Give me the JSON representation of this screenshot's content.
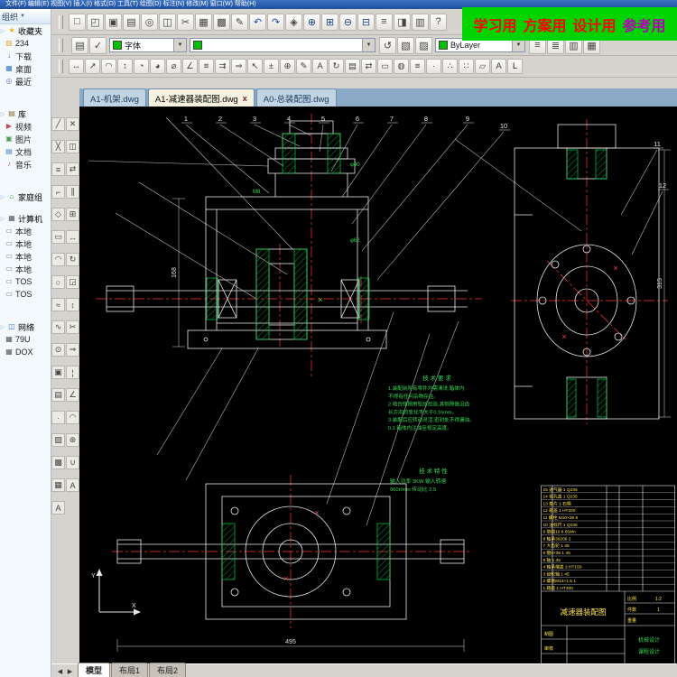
{
  "window": {
    "menu": "文件(F) 编辑(E) 视图(V) 插入(I) 格式(O) 工具(T) 绘图(D) 标注(N) 修改(M) 窗口(W) 帮助(H)"
  },
  "icons": {
    "dropdown": "▼",
    "prev": "◀",
    "next": "▶",
    "close": "x",
    "tri": "▷"
  },
  "banner": {
    "bg": "#00d400",
    "fg": "#ff0000",
    "fg_alt": "#b400b4",
    "words": [
      "学习用",
      "方案用",
      "设计用",
      "参考用"
    ]
  },
  "toolbars": {
    "font_combo": "字体",
    "layer_value": "",
    "bylayer": "ByLayer",
    "row1": [
      {
        "n": "new",
        "g": "□"
      },
      {
        "n": "open",
        "g": "◰"
      },
      {
        "n": "save",
        "g": "▣"
      },
      {
        "n": "plot",
        "g": "▤"
      },
      {
        "n": "plot-preview",
        "g": "◎"
      },
      {
        "n": "publish",
        "g": "◫"
      },
      {
        "n": "cut",
        "g": "✂"
      },
      {
        "n": "copy",
        "g": "▦"
      },
      {
        "n": "paste",
        "g": "▩"
      },
      {
        "n": "match-properties",
        "g": "✎"
      },
      {
        "n": "undo",
        "g": "↶",
        "c": "#2244bb"
      },
      {
        "n": "redo",
        "g": "↷",
        "c": "#2244bb"
      },
      {
        "n": "pan",
        "g": "◈"
      },
      {
        "n": "zoom-realtime",
        "g": "⊕",
        "c": "#224488"
      },
      {
        "n": "zoom-window",
        "g": "⊞",
        "c": "#224488"
      },
      {
        "n": "zoom-out",
        "g": "⊖",
        "c": "#224488"
      },
      {
        "n": "zoom-previous",
        "g": "⊟",
        "c": "#224488"
      },
      {
        "n": "properties",
        "g": "≡"
      },
      {
        "n": "design-center",
        "g": "◨"
      },
      {
        "n": "tool-palettes",
        "g": "▥"
      },
      {
        "n": "help",
        "g": "?"
      }
    ],
    "row2_left": [
      {
        "n": "layer-properties",
        "g": "▤"
      },
      {
        "n": "layer-states",
        "g": "✓"
      }
    ],
    "row2_mid": [
      {
        "n": "layer-previous",
        "g": "↺"
      },
      {
        "n": "make-object-layer",
        "g": "▧"
      },
      {
        "n": "layer-isolate",
        "g": "▨"
      }
    ],
    "row2_right": [
      {
        "n": "linetype",
        "g": "≡"
      },
      {
        "n": "lineweight",
        "g": "≣"
      },
      {
        "n": "plot-style",
        "g": "▥"
      },
      {
        "n": "table-style",
        "g": "▦"
      }
    ],
    "row3": [
      {
        "n": "dim-linear",
        "g": "↔"
      },
      {
        "n": "dim-aligned",
        "g": "↗"
      },
      {
        "n": "dim-arc-length",
        "g": "◠"
      },
      {
        "n": "dim-ordinate",
        "g": "↕"
      },
      {
        "n": "dim-radius",
        "g": "◔"
      },
      {
        "n": "dim-jogged",
        "g": "◕"
      },
      {
        "n": "dim-diameter",
        "g": "⌀"
      },
      {
        "n": "dim-angular",
        "g": "∠"
      },
      {
        "n": "quick-dim",
        "g": "≡"
      },
      {
        "n": "dim-baseline",
        "g": "⇉"
      },
      {
        "n": "dim-continue",
        "g": "⇒"
      },
      {
        "n": "quick-leader",
        "g": "↖"
      },
      {
        "n": "tolerance",
        "g": "±"
      },
      {
        "n": "center-mark",
        "g": "⊕"
      },
      {
        "n": "dim-edit",
        "g": "✎"
      },
      {
        "n": "dim-text-edit",
        "g": "A"
      },
      {
        "n": "dim-update",
        "g": "↻"
      },
      {
        "n": "dim-style",
        "g": "▤"
      },
      {
        "n": "distance",
        "g": "⇄"
      },
      {
        "n": "area",
        "g": "▭"
      },
      {
        "n": "mass-properties",
        "g": "◍"
      },
      {
        "n": "list",
        "g": "≡"
      },
      {
        "n": "locate-point",
        "g": "∙"
      },
      {
        "n": "divide",
        "g": "∴"
      },
      {
        "n": "measure",
        "g": "∷"
      },
      {
        "n": "region-tool",
        "g": "▱"
      },
      {
        "n": "text-style",
        "g": "A"
      },
      {
        "n": "corner",
        "g": "L",
        "c": "#222"
      }
    ]
  },
  "sidebar": {
    "draw": [
      {
        "n": "line",
        "g": "╱"
      },
      {
        "n": "construction-line",
        "g": "╳"
      },
      {
        "n": "multiline",
        "g": "≡"
      },
      {
        "n": "polyline",
        "g": "⌐"
      },
      {
        "n": "polygon",
        "g": "◇"
      },
      {
        "n": "rectangle",
        "g": "▭"
      },
      {
        "n": "arc",
        "g": "◠"
      },
      {
        "n": "circle",
        "g": "○"
      },
      {
        "n": "revision-cloud",
        "g": "≈"
      },
      {
        "n": "spline",
        "g": "∿"
      },
      {
        "n": "ellipse",
        "g": "⊙"
      },
      {
        "n": "insert-block",
        "g": "▣"
      },
      {
        "n": "make-block",
        "g": "▤"
      },
      {
        "n": "point",
        "g": "∙"
      },
      {
        "n": "hatch",
        "g": "▨"
      },
      {
        "n": "gradient",
        "g": "▩"
      },
      {
        "n": "region",
        "g": "▦"
      },
      {
        "n": "mtext",
        "g": "A"
      }
    ],
    "modify": [
      {
        "n": "erase",
        "g": "✕"
      },
      {
        "n": "copy-object",
        "g": "◫"
      },
      {
        "n": "mirror",
        "g": "⇄"
      },
      {
        "n": "offset",
        "g": "∥"
      },
      {
        "n": "array",
        "g": "⊞"
      },
      {
        "n": "move",
        "g": "↔"
      },
      {
        "n": "rotate",
        "g": "↻"
      },
      {
        "n": "scale",
        "g": "◲"
      },
      {
        "n": "stretch",
        "g": "↕"
      },
      {
        "n": "trim",
        "g": "✂"
      },
      {
        "n": "extend",
        "g": "⇒"
      },
      {
        "n": "break",
        "g": "¦"
      },
      {
        "n": "chamfer",
        "g": "∠"
      },
      {
        "n": "fillet",
        "g": "◠"
      },
      {
        "n": "explode",
        "g": "⊛"
      },
      {
        "n": "join",
        "g": "∪"
      },
      {
        "n": "text-tool",
        "g": "A"
      }
    ]
  },
  "explorer": {
    "organize": "组织",
    "items": [
      {
        "type": "header",
        "id": "favorites",
        "icon": "star",
        "label": "收藏夹"
      },
      {
        "type": "item",
        "id": "folder-234",
        "icon": "folder",
        "label": "234"
      },
      {
        "type": "item",
        "id": "downloads",
        "icon": "download",
        "label": "下载"
      },
      {
        "type": "item",
        "id": "desktop",
        "icon": "desktop",
        "label": "桌面"
      },
      {
        "type": "item",
        "id": "recent",
        "icon": "recent",
        "label": "最近"
      },
      {
        "type": "gap"
      },
      {
        "type": "header",
        "id": "libraries",
        "icon": "lib",
        "label": "库"
      },
      {
        "type": "item",
        "id": "videos",
        "icon": "video",
        "label": "视频"
      },
      {
        "type": "item",
        "id": "pictures",
        "icon": "pic",
        "label": "图片"
      },
      {
        "type": "item",
        "id": "documents",
        "icon": "doc",
        "label": "文档"
      },
      {
        "type": "item",
        "id": "music",
        "icon": "music",
        "label": "音乐"
      },
      {
        "type": "gap"
      },
      {
        "type": "header",
        "id": "homegroup",
        "icon": "home",
        "label": "家庭组"
      },
      {
        "type": "gap-sm"
      },
      {
        "type": "header",
        "id": "computer",
        "icon": "computer",
        "label": "计算机"
      },
      {
        "type": "item",
        "id": "disk-1",
        "icon": "disk",
        "label": "本地"
      },
      {
        "type": "item",
        "id": "disk-2",
        "icon": "disk",
        "label": "本地"
      },
      {
        "type": "item",
        "id": "disk-3",
        "icon": "disk",
        "label": "本地"
      },
      {
        "type": "item",
        "id": "disk-4",
        "icon": "disk",
        "label": "本地"
      },
      {
        "type": "item",
        "id": "tos-1",
        "icon": "disk",
        "label": "TOS"
      },
      {
        "type": "item",
        "id": "tos-2",
        "icon": "disk",
        "label": "TOS"
      },
      {
        "type": "gap"
      },
      {
        "type": "header",
        "id": "network",
        "icon": "network",
        "label": "网络"
      },
      {
        "type": "item",
        "id": "pc-79u",
        "icon": "pc",
        "label": "79U"
      },
      {
        "type": "item",
        "id": "pc-dox",
        "icon": "pc",
        "label": "DOX"
      }
    ]
  },
  "tabs": [
    {
      "label": "A1-机架.dwg",
      "active": false
    },
    {
      "label": "A1-减速器装配图.dwg",
      "active": true
    },
    {
      "label": "A0-总装配图.dwg",
      "active": false
    }
  ],
  "statusbar": {
    "tabs": [
      "模型",
      "布局1",
      "布局2"
    ],
    "active": 0
  },
  "drawing": {
    "bg": "#000000",
    "line": "#e8e8e8",
    "hatch": "#00cc44",
    "center": "#ff3333",
    "bom_text": "#ffe34d",
    "note_text": "#33dd55",
    "balloons": [
      "1",
      "2",
      "3",
      "4",
      "5",
      "6",
      "7",
      "8",
      "9",
      "10",
      "11",
      "12"
    ],
    "marker": "×",
    "notes_title": "技 术 要 求",
    "notes": [
      "1.装配前所有零件均需清洗,箱体内",
      "   不得有任何杂物存在。",
      "2.啮合侧隙用铅丝检验,其侧隙值沿齿",
      "   长方向的变化不大于0.16mm。",
      "3.装配后应转动灵活,密封处不得漏油。",
      "0.1 箱体内注油至规定高度。"
    ],
    "spec_title": "技 术 特 性",
    "spec": [
      "输入功率 3KW  输入转速",
      "960r/min  传动比 2.5"
    ],
    "dims": {
      "bottom_width": "495",
      "right_height": "315",
      "left_height": "168",
      "d1": "φ40",
      "d2": "φ62",
      "d3": "M8"
    },
    "bom_rows": [
      "15 通气器 1 Q235",
      "14 视孔盖 1 Q235",
      "13 垫片 1 石棉",
      "12 箱盖 1 HT200",
      "11 螺栓 M10×35 6",
      "10 油标尺 1 Q235",
      "9 垫圈10 6 65Mn",
      "8 轴承30206 2",
      "7 大齿轮 1 45",
      "6 键8×36 1 45",
      "5 轴 1 45",
      "4 轴承端盖 2 HT150",
      "3 齿轮轴 1 45",
      "2 螺塞M14×1.5 1",
      "1 箱座 1 HT200"
    ],
    "title_block": {
      "name": "减速器装配图",
      "scale_label": "比例",
      "scale": "1:2",
      "qty_label": "件数",
      "qty": "1",
      "weight_label": "重量",
      "drafter": "制图",
      "checker": "审核",
      "course1": "机械设计",
      "course2": "课程设计"
    },
    "ucs": {
      "x": "X",
      "y": "Y"
    }
  }
}
